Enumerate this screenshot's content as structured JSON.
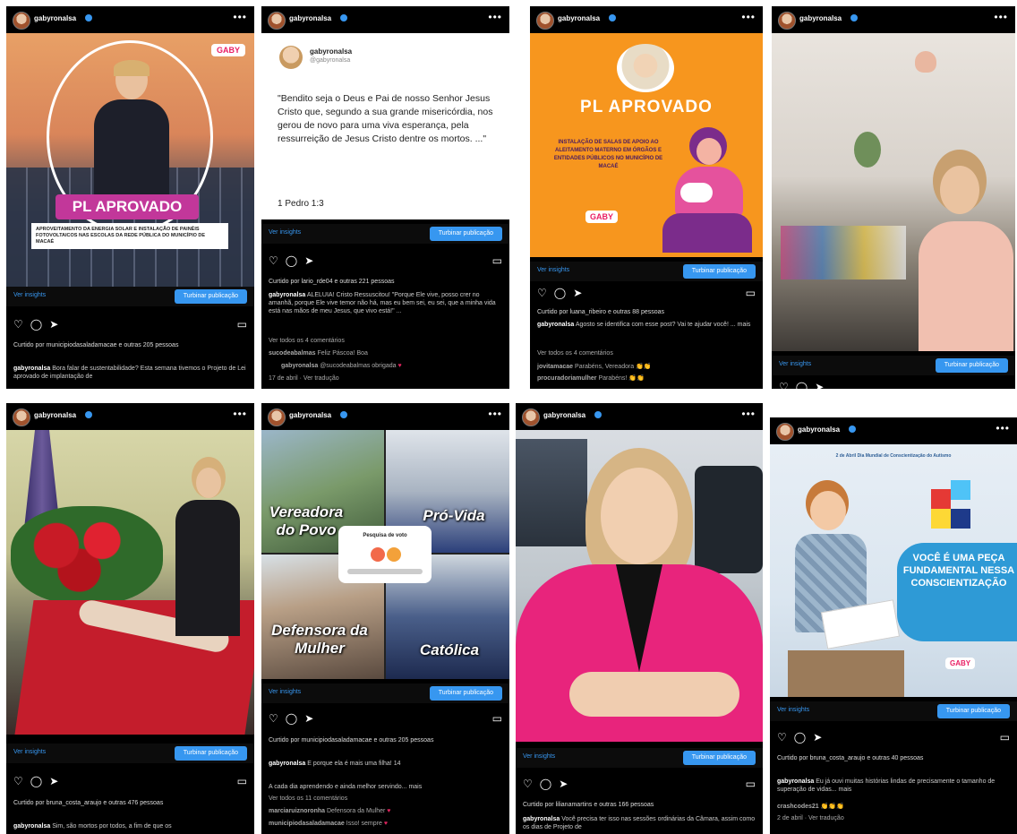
{
  "username": "gabyronalsa",
  "ui": {
    "insights": "Ver insights",
    "promote": "Turbinar publicação"
  },
  "posts": [
    {
      "overlay_title": "PL APROVADO",
      "overlay_body": "APROVEITAMENTO DA ENERGIA SOLAR E INSTALAÇÃO DE PAINÉIS FOTOVOLTAICOS NAS ESCOLAS DA REDE PÚBLICA DO MUNICÍPIO DE MACAÉ",
      "badge": "GABY",
      "liked_by": "Curtido por municipiodasaladamacae e outras 205 pessoas",
      "caption_user": "gabyronalsa",
      "caption": "Bora falar de sustentabilidade? Esta semana tivemos o Projeto de Lei aprovado de implantação de"
    },
    {
      "tweet_name": "gabyronalsa",
      "tweet_handle": "@gabyronalsa",
      "tweet_text": "\"Bendito seja o Deus e Pai de nosso Senhor Jesus Cristo que, segundo a sua grande misericórdia, nos gerou de novo para uma viva esperança, pela ressurreição de Jesus Cristo dentre os mortos. ...\"",
      "tweet_ref": "1 Pedro 1:3",
      "liked_by": "Curtido por lario_rde04 e outras 221 pessoas",
      "caption_user": "gabyronalsa",
      "caption": "ALELUIA! Cristo Ressuscitou! \"Porque Ele vive, posso crer no amanhã, porque Ele vive temor não há, mas eu bem sei, eu sei, que a minha vida está nas mãos de meu Jesus, que vivo está!\" ...",
      "comments_link": "Ver todos os 4 comentários",
      "c1_user": "sucodeabalmas",
      "c1_text": "Feliz Páscoa! Boa",
      "c2_user": "gabyronalsa",
      "c2_text": "@sucodeabalmas obrigada",
      "time": "17 de abril · Ver tradução"
    },
    {
      "title": "PL APROVADO",
      "body": "INSTALAÇÃO DE SALAS DE APOIO AO ALEITAMENTO MATERNO EM ÓRGÃOS E ENTIDADES PÚBLICOS NO MUNICÍPIO DE MACAÉ",
      "badge": "GABY",
      "liked_by": "Curtido por luana_ribeiro e outras 88 pessoas",
      "caption_user": "gabyronalsa",
      "caption": "Agosto se identifica com esse post? Vai te ajudar você! ... mais",
      "comments_link": "Ver todos os 4 comentários",
      "c1_user": "jovitamacae",
      "c1_text": "Parabéns, Vereadora",
      "c2_user": "procuradoriamulher",
      "c2_text": "Parabéns!"
    },
    {
      "scene": "office"
    },
    {
      "liked_by": "Curtido por bruna_costa_araujo e outras 476 pessoas",
      "caption_user": "gabyronalsa",
      "caption": "Sim, são mortos por todos, a fim de que os"
    },
    {
      "label_tl": "Vereadora do Povo",
      "label_tr": "Pró-Vida",
      "label_bl": "Defensora da Mulher",
      "label_br": "Católica",
      "popup_title": "Pesquisa de voto",
      "liked_by": "Curtido por municipiodasaladamacae e outras 205 pessoas",
      "caption_user": "gabyronalsa",
      "caption": "E porque ela é mais uma filha! 14",
      "line2": "A cada dia aprendendo e ainda melhor servindo... mais",
      "comments_link": "Ver todos os 11 comentários",
      "c1_user": "marciaruiznoronha",
      "c1_text": "Defensora da Mulher",
      "c2_user": "municipiodasaladamacae",
      "c2_text": "Isso! sempre"
    },
    {
      "liked_by": "Curtido por lilianamartins e outras 166 pessoas",
      "caption_user": "gabyronalsa",
      "caption": "Você precisa ter isso nas sessões ordinárias da Câmara, assim como os dias de Projeto de"
    },
    {
      "header_small": "2 de Abril Dia Mundial de Conscientização do Autismo",
      "title": "VOCÊ É UMA PEÇA FUNDAMENTAL NESSA CONSCIENTIZAÇÃO",
      "badge": "GABY",
      "liked_by": "Curtido por bruna_costa_araujo e outras 40 pessoas",
      "caption_user": "gabyronalsa",
      "caption": "Eu já ouvi muitas histórias lindas de precisamente o tamanho de superação de vidas... mais",
      "c1_user": "crashcodes21",
      "time": "2 de abril · Ver tradução"
    }
  ]
}
